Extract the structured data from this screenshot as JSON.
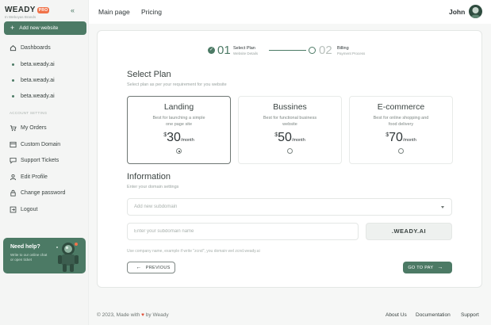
{
  "brand": {
    "name": "WEADY",
    "badge": "PRO",
    "tagline": "In Weboyas Brands"
  },
  "colors": {
    "accent": "#4c7a65",
    "heart": "#e0533b"
  },
  "sidebar": {
    "collapse_icon": "double-chevron-left-icon",
    "add_button": "Add new website",
    "items": [
      {
        "label": "Dashboards",
        "icon": "house-icon"
      },
      {
        "label": "beta.weady.ai",
        "icon": "dot-icon"
      },
      {
        "label": "beta.weady.ai",
        "icon": "dot-icon"
      },
      {
        "label": "beta.weady.ai",
        "icon": "dot-icon"
      }
    ],
    "section_label": "ACCOUNT SETTING",
    "account_items": [
      {
        "label": "My Orders",
        "icon": "cart-icon"
      },
      {
        "label": "Custom Domain",
        "icon": "domain-icon"
      },
      {
        "label": "Support Tickets",
        "icon": "chat-icon"
      },
      {
        "label": "Edit Profile",
        "icon": "user-icon"
      },
      {
        "label": "Change password",
        "icon": "lock-icon"
      },
      {
        "label": "Logout",
        "icon": "logout-icon"
      }
    ],
    "help": {
      "title": "Need help?",
      "text": "Write to our online chat or open ticket"
    }
  },
  "topnav": {
    "links": [
      "Main page",
      "Pricing"
    ],
    "user_name": "John"
  },
  "stepper": [
    {
      "num": "01",
      "title": "Select Plan",
      "sub": "Website Details",
      "done": true
    },
    {
      "num": "02",
      "title": "Billing",
      "sub": "Payment Process",
      "done": false
    }
  ],
  "plans_section": {
    "title": "Select Plan",
    "subtitle": "Select plan as per your requirement for you website"
  },
  "plans": [
    {
      "name": "Landing",
      "desc": "Best for launching a simple one page site",
      "currency": "$",
      "price": "30",
      "period": "/month",
      "selected": true
    },
    {
      "name": "Bussines",
      "desc": "Best for functional business website",
      "currency": "$",
      "price": "50",
      "period": "/month",
      "selected": false
    },
    {
      "name": "E-commerce",
      "desc": "Best for online shopping and food delivery",
      "currency": "$",
      "price": "70",
      "period": "/month",
      "selected": false
    }
  ],
  "info": {
    "title": "Information",
    "subtitle": "Enter your domain settings",
    "select_placeholder": "Add new subdomain",
    "input_placeholder": "Enter your subdomain name",
    "suffix": ".WEADY.AI",
    "hint": "Use company name, example if write \"zcnd\", you domain wel zcnd.weady.ai"
  },
  "buttons": {
    "previous": "PREVIOUS",
    "next": "GO TO PAY"
  },
  "footer": {
    "copy_pre": "© 2023, Made with",
    "copy_post": "by Weady",
    "links": [
      "About Us",
      "Documentation",
      "Support"
    ]
  }
}
